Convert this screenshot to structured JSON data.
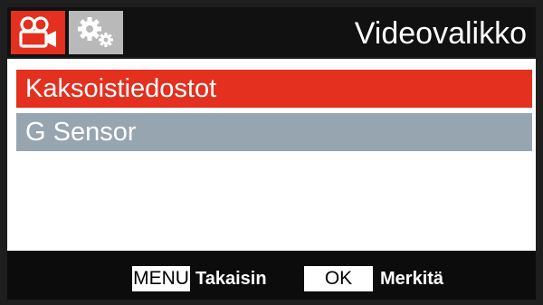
{
  "header": {
    "title": "Videovalikko",
    "tabs": [
      {
        "icon": "video-camera-icon",
        "selected": true
      },
      {
        "icon": "gears-icon",
        "selected": false
      }
    ]
  },
  "menu": {
    "items": [
      {
        "label": "Kaksoistiedostot",
        "selected": true
      },
      {
        "label": "G Sensor",
        "selected": false
      }
    ]
  },
  "footer": {
    "menu_key": "MENU",
    "menu_action": "Takaisin",
    "ok_key": "OK",
    "ok_action": "Merkitä"
  },
  "colors": {
    "accent": "#e3301f",
    "item_normal": "#97a5b0",
    "tab_inactive": "#b9b9b9",
    "background": "#111111"
  }
}
